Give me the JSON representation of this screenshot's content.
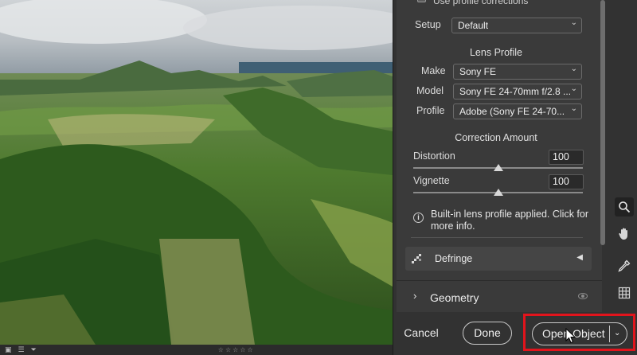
{
  "panel": {
    "top_cut_label": "Use profile corrections",
    "setup": {
      "label": "Setup",
      "value": "Default"
    },
    "lens_profile_title": "Lens Profile",
    "make": {
      "label": "Make",
      "value": "Sony FE"
    },
    "model": {
      "label": "Model",
      "value": "Sony FE 24-70mm f/2.8 ..."
    },
    "profile": {
      "label": "Profile",
      "value": "Adobe (Sony FE 24-70..."
    },
    "correction_title": "Correction Amount",
    "distortion": {
      "label": "Distortion",
      "value": "100",
      "level": 1.0
    },
    "vignette": {
      "label": "Vignette",
      "value": "100",
      "level": 1.0
    },
    "info_text": "Built-in lens profile applied.  Click for more info.",
    "defringe_label": "Defringe",
    "geometry_label": "Geometry"
  },
  "footer": {
    "cancel": "Cancel",
    "done": "Done",
    "open_object": "Open Object"
  },
  "tools": [
    "zoom-icon",
    "hand-icon",
    "eyedropper-icon",
    "grid-icon"
  ],
  "colors": {
    "panel_bg": "#3a3a3a",
    "highlight_red": "#e2141c"
  }
}
